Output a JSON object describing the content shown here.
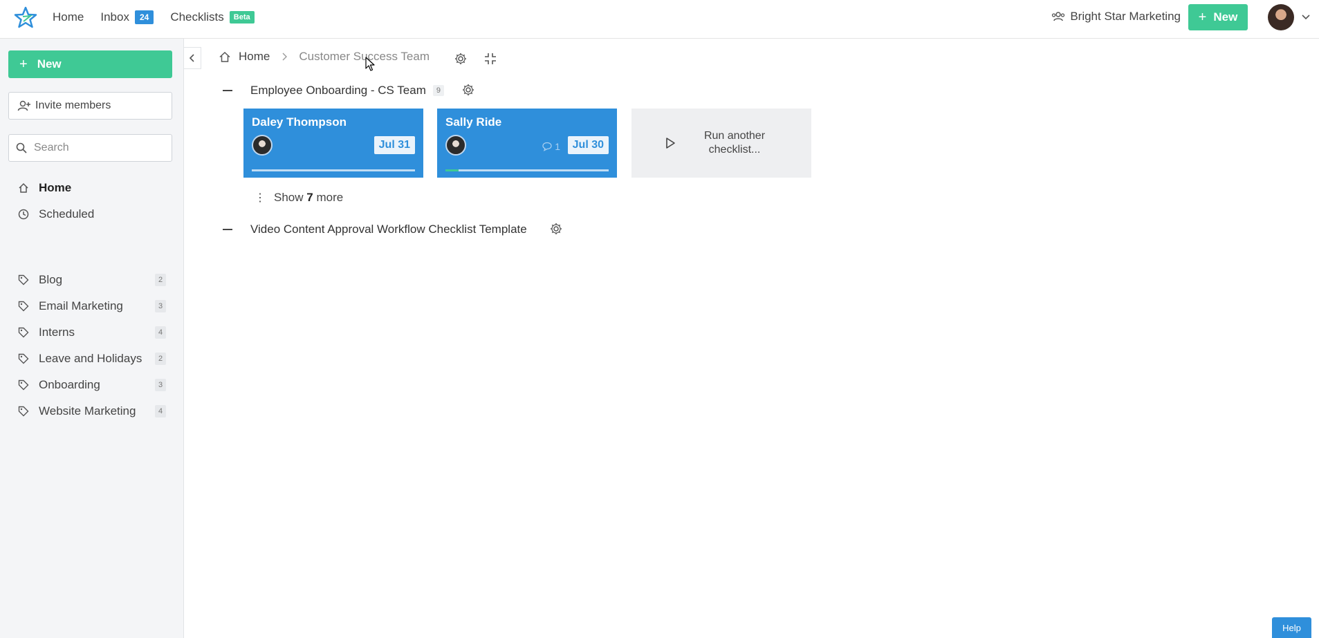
{
  "topbar": {
    "nav": [
      {
        "label": "Home"
      },
      {
        "label": "Inbox",
        "badge": "24"
      },
      {
        "label": "Checklists",
        "badge": "Beta"
      }
    ],
    "org_name": "Bright Star Marketing",
    "new_label": "New"
  },
  "sidebar": {
    "new_label": "New",
    "invite_label": "Invite members",
    "search_placeholder": "Search",
    "primary": [
      {
        "label": "Home",
        "icon": "home-icon",
        "active": true
      },
      {
        "label": "Scheduled",
        "icon": "clock-icon"
      }
    ],
    "tags": [
      {
        "label": "Blog",
        "count": "2"
      },
      {
        "label": "Email Marketing",
        "count": "3"
      },
      {
        "label": "Interns",
        "count": "4"
      },
      {
        "label": "Leave and Holidays",
        "count": "2"
      },
      {
        "label": "Onboarding",
        "count": "3"
      },
      {
        "label": "Website Marketing",
        "count": "4"
      }
    ]
  },
  "breadcrumb": {
    "home": "Home",
    "current": "Customer Success Team"
  },
  "groups": [
    {
      "title": "Employee Onboarding - CS Team",
      "count": "9"
    },
    {
      "title": "Video Content Approval Workflow Checklist Template"
    }
  ],
  "cards": [
    {
      "name": "Daley Thompson",
      "due": "Jul 31",
      "progress": 0
    },
    {
      "name": "Sally Ride",
      "due": "Jul 30",
      "comments": "1",
      "progress": 0.08
    }
  ],
  "run_another": "Run another checklist...",
  "show_more": {
    "prefix": "Show",
    "count": "7",
    "suffix": "more"
  },
  "help_label": "Help",
  "colors": {
    "accent_green": "#3fc995",
    "accent_blue": "#2f8fdb"
  }
}
